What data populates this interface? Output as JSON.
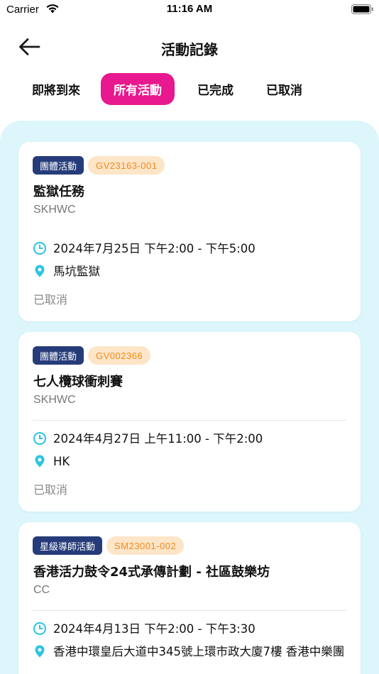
{
  "status_bar": {
    "carrier": "Carrier",
    "time": "11:16 AM"
  },
  "header": {
    "title": "活動記錄"
  },
  "tabs": [
    {
      "label": "即將到來",
      "active": false
    },
    {
      "label": "所有活動",
      "active": true
    },
    {
      "label": "已完成",
      "active": false
    },
    {
      "label": "已取消",
      "active": false
    }
  ],
  "colors": {
    "accent": "#e8188e",
    "panel_bg": "#dcf6fc",
    "badge_type_bg": "#263c7a",
    "badge_code_bg": "#fde5c8",
    "badge_code_text": "#f18a1b",
    "icon": "#2bc4e0"
  },
  "icons": {
    "back": "arrow-left-icon",
    "time": "clock-icon",
    "location": "map-pin-icon"
  },
  "activities": [
    {
      "type": "團體活動",
      "code": "GV23163-001",
      "title": "監獄任務",
      "org": "SKHWC",
      "datetime": "2024年7月25日 下午2:00 - 下午5:00",
      "location": "馬坑監獄",
      "status": "已取消"
    },
    {
      "type": "團體活動",
      "code": "GV002366",
      "title": "七人欖球衝刺賽",
      "org": "SKHWC",
      "datetime": "2024年4月27日 上午11:00 - 下午2:00",
      "location": "HK",
      "status": "已取消"
    },
    {
      "type": "星級導師活動",
      "code": "SM23001-002",
      "title": "香港活力鼓令24式承傳計劃 - 社區鼓樂坊",
      "org": "CC",
      "datetime": "2024年4月13日 下午2:00 - 下午3:30",
      "location": "香港中環皇后大道中345號上環市政大廈7樓 香港中樂團",
      "status": ""
    }
  ]
}
